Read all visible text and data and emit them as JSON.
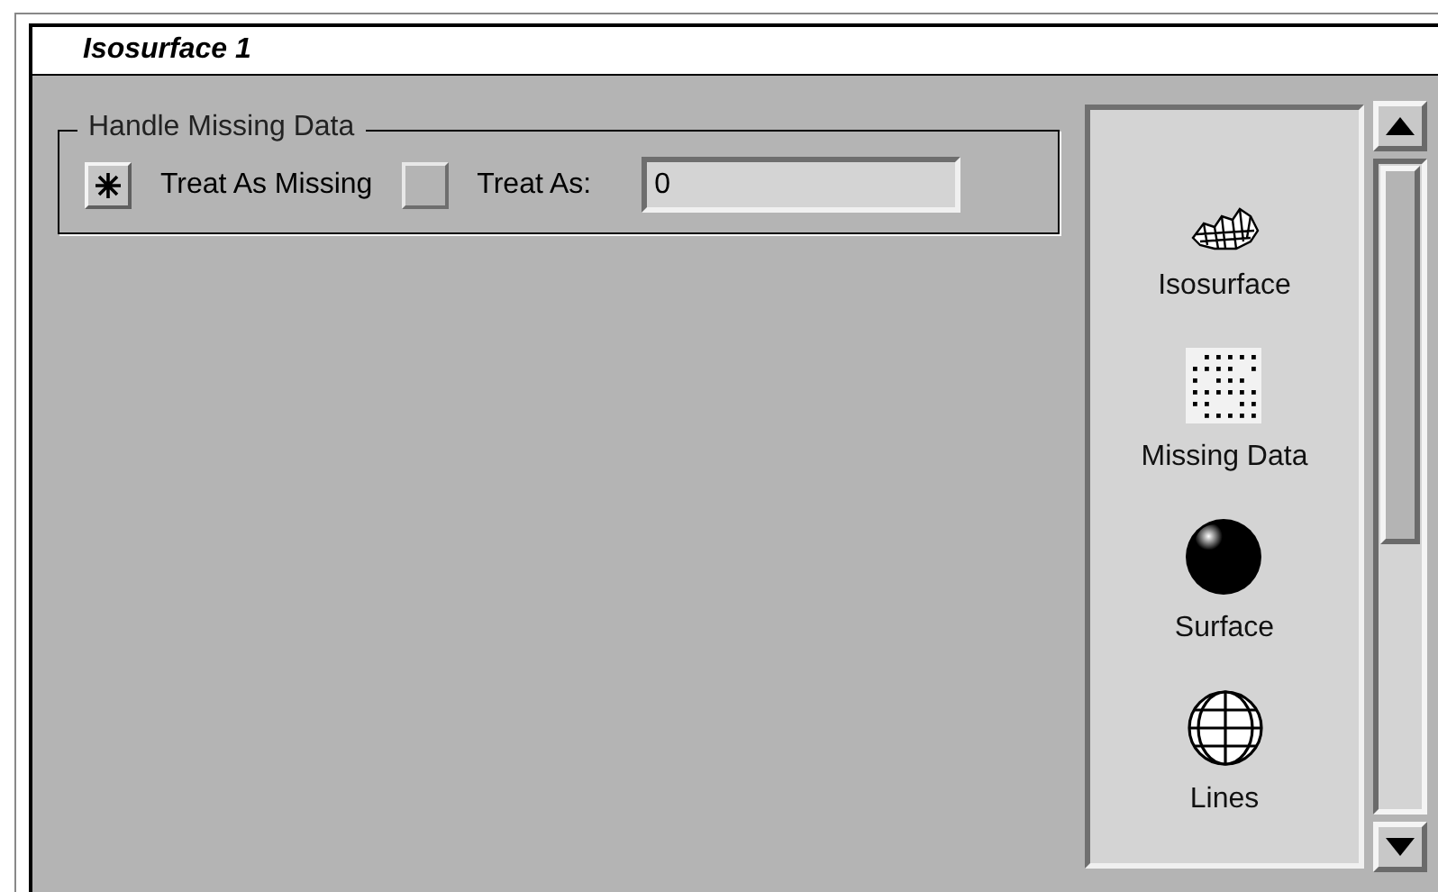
{
  "window": {
    "title": "Isosurface 1"
  },
  "missing_data": {
    "label": "Handle Missing Data",
    "options": [
      {
        "label": "Treat As Missing",
        "selected": true
      },
      {
        "label": "Treat As:",
        "selected": false,
        "value": "0"
      }
    ]
  },
  "modules": [
    {
      "kind": "isosurface",
      "label": "Isosurface"
    },
    {
      "kind": "dots",
      "label": "Missing Data"
    },
    {
      "kind": "sphere",
      "label": "Surface"
    },
    {
      "kind": "globe",
      "label": "Lines"
    }
  ]
}
